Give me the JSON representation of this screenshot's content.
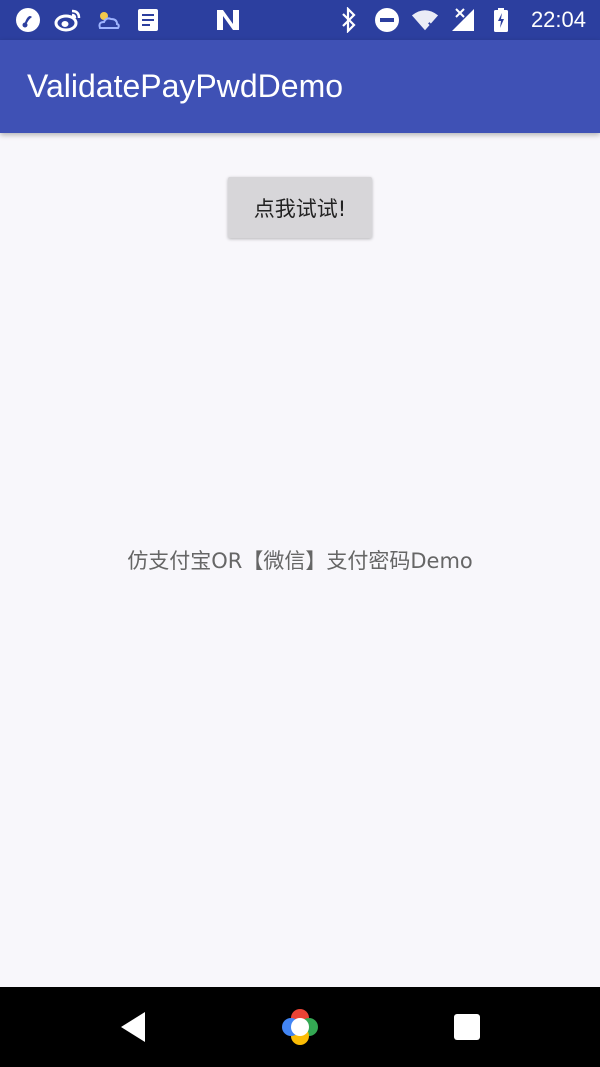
{
  "status_bar": {
    "time": "22:04",
    "left_icons": [
      "music-app-icon",
      "weibo-icon",
      "weather-icon",
      "notes-icon",
      "n-icon"
    ],
    "right_icons": [
      "bluetooth-icon",
      "do-not-disturb-icon",
      "wifi-icon",
      "signal-icon",
      "battery-icon"
    ]
  },
  "app_bar": {
    "title": "ValidatePayPwdDemo"
  },
  "main": {
    "try_button_label": "点我试试!",
    "description": "仿支付宝OR【微信】支付密码Demo"
  },
  "nav_bar": {
    "buttons": [
      "back",
      "home",
      "recents"
    ]
  },
  "colors": {
    "status_bar": "#2c3f9f",
    "app_bar": "#3f51b5",
    "background": "#f8f7fb",
    "button": "#d7d6d9",
    "nav_bar": "#000000"
  }
}
